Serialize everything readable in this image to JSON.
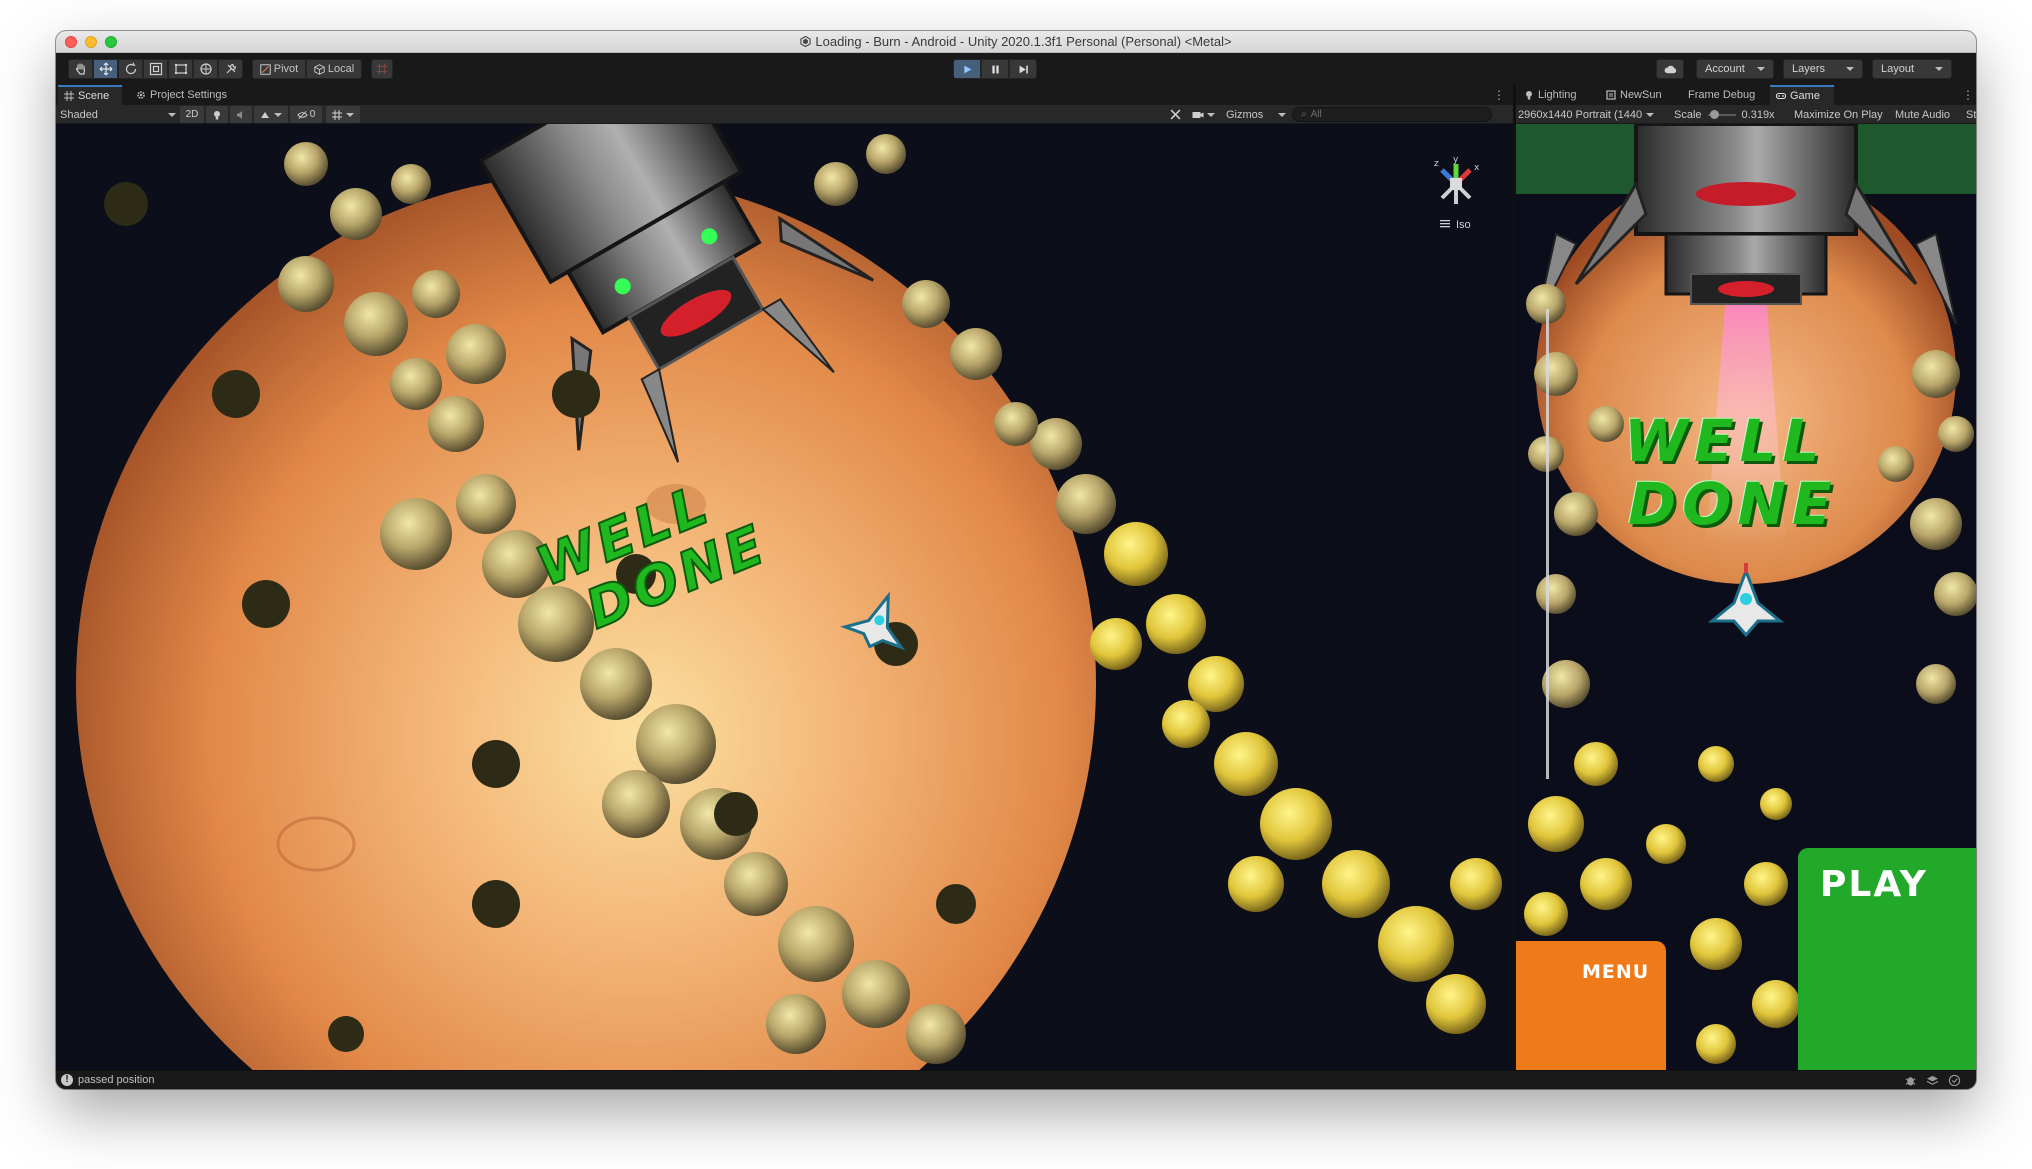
{
  "window": {
    "title": "Loading - Burn - Android - Unity 2020.1.3f1 Personal (Personal) <Metal>"
  },
  "toolbar": {
    "tools": [
      "hand-tool",
      "move-tool",
      "rotate-tool",
      "scale-tool",
      "rect-tool",
      "transform-tool",
      "custom-tool"
    ],
    "pivot_label": "Pivot",
    "local_label": "Local",
    "account_label": "Account",
    "layers_label": "Layers",
    "layout_label": "Layout"
  },
  "scene_tabs": {
    "scene_label": "Scene",
    "project_settings_label": "Project Settings"
  },
  "game_tabs": {
    "lighting_label": "Lighting",
    "newsun_label": "NewSun",
    "frame_debug_label": "Frame Debug",
    "game_label": "Game"
  },
  "scene_controls": {
    "shading_mode": "Shaded",
    "twod_label": "2D",
    "hidden_count": "0",
    "gizmos_label": "Gizmos",
    "search_placeholder": "All"
  },
  "game_controls": {
    "resolution": "2960x1440 Portrait (1440",
    "scale_label": "Scale",
    "scale_value": "0.319x",
    "maximize_label": "Maximize On Play",
    "mute_label": "Mute Audio",
    "stats_label": "St"
  },
  "scene_view": {
    "projection_label": "Iso",
    "well_label": "WELL",
    "done_label": "DONE"
  },
  "game_view": {
    "well_label": "WELL",
    "done_label": "DONE",
    "play_label": "PLAY",
    "menu_label": "MENU"
  },
  "statusbar": {
    "message": "passed position"
  },
  "colors": {
    "editor_bg": "#191919",
    "panel_bg": "#282828",
    "play_accent": "#46607c",
    "well_done_green": "#1fb81f",
    "play_button_green": "#22a92a",
    "menu_button_orange": "#ef7a1a",
    "planet_orange": "#e9974f"
  }
}
